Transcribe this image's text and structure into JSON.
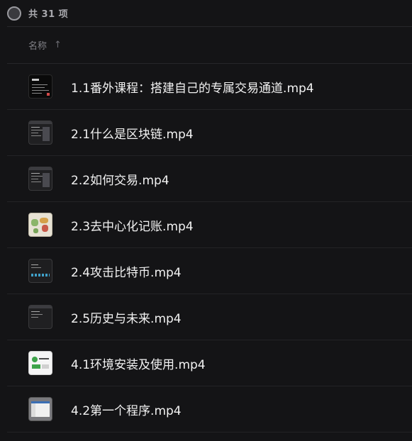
{
  "header": {
    "count_text": "共 31 项"
  },
  "column": {
    "name_label": "名称",
    "sort_icon": "arrow-up-icon"
  },
  "files": [
    {
      "name": "1.1番外课程：搭建自己的专属交易通道.mp4",
      "thumb": "dark"
    },
    {
      "name": "2.1什么是区块链.mp4",
      "thumb": "term"
    },
    {
      "name": "2.2如何交易.mp4",
      "thumb": "term"
    },
    {
      "name": "2.3去中心化记账.mp4",
      "thumb": "map"
    },
    {
      "name": "2.4攻击比特币.mp4",
      "thumb": "blue"
    },
    {
      "name": "2.5历史与未来.mp4",
      "thumb": "term"
    },
    {
      "name": "4.1环境安装及使用.mp4",
      "thumb": "white"
    },
    {
      "name": "4.2第一个程序.mp4",
      "thumb": "prog"
    }
  ]
}
